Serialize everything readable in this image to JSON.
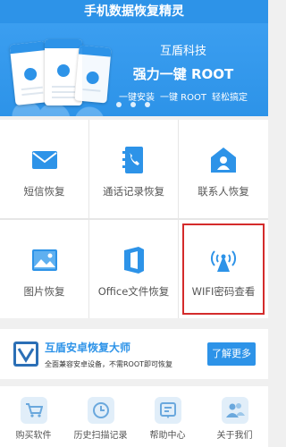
{
  "app": {
    "title": "手机数据恢复精灵"
  },
  "banner": {
    "company": "互盾科技",
    "headline": "强力一键 ROOT",
    "features": [
      "一键安装",
      "一键 ROOT",
      "轻松搞定"
    ],
    "page_indicator_count": 3
  },
  "grid": {
    "tiles": [
      {
        "label": "短信恢复",
        "icon": "sms-icon"
      },
      {
        "label": "通话记录恢复",
        "icon": "call-log-icon"
      },
      {
        "label": "联系人恢复",
        "icon": "contact-icon"
      },
      {
        "label": "图片恢复",
        "icon": "photo-icon"
      },
      {
        "label": "Office文件恢复",
        "icon": "office-icon"
      },
      {
        "label": "WIFI密码查看",
        "icon": "wifi-icon",
        "highlighted": true
      }
    ]
  },
  "promo": {
    "title": "互盾安卓恢复大师",
    "description": "全面兼容安卓设备，不需ROOT即可恢复",
    "button_label": "了解更多"
  },
  "tabbar": {
    "tabs": [
      {
        "label": "购买软件",
        "icon": "cart-icon"
      },
      {
        "label": "历史扫描记录",
        "icon": "clock-icon"
      },
      {
        "label": "帮助中心",
        "icon": "help-icon"
      },
      {
        "label": "关于我们",
        "icon": "people-icon"
      }
    ]
  },
  "colors": {
    "primary": "#2d93e8",
    "highlight_border": "#d42b2b"
  }
}
